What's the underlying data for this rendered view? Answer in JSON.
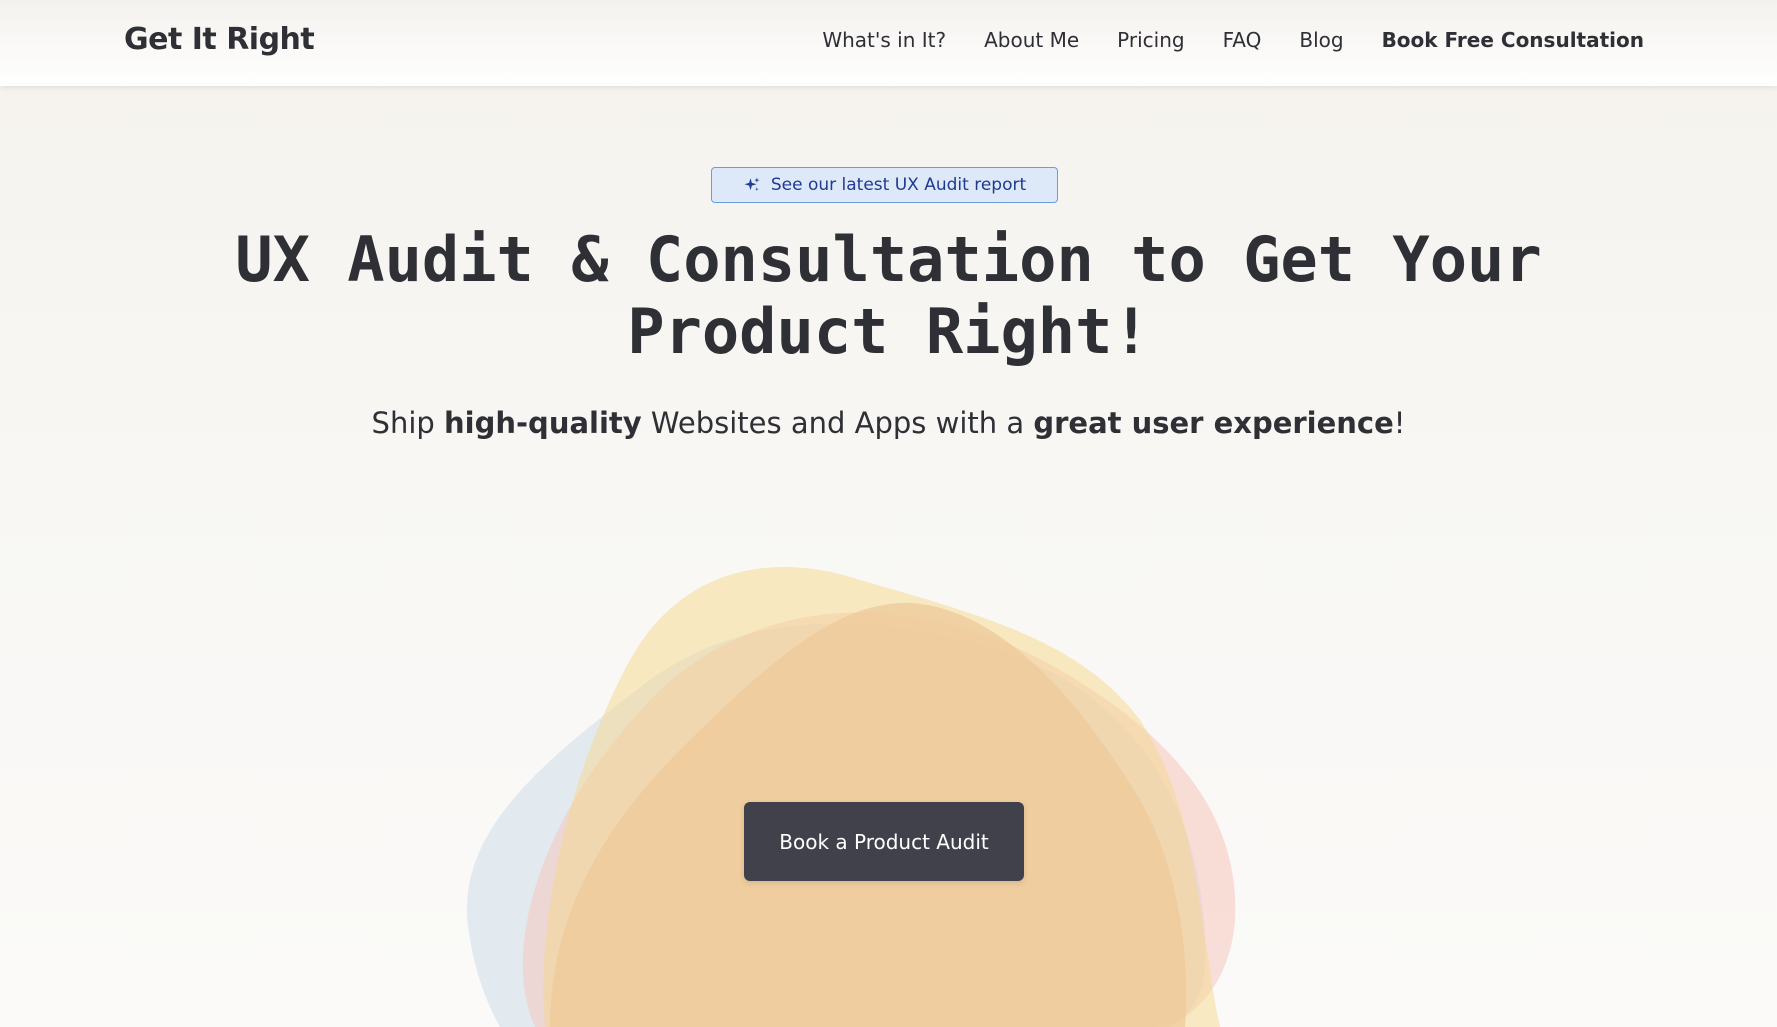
{
  "header": {
    "logo": "Get It Right",
    "nav": [
      {
        "label": "What's in It?"
      },
      {
        "label": "About Me"
      },
      {
        "label": "Pricing"
      },
      {
        "label": "FAQ"
      },
      {
        "label": "Blog"
      },
      {
        "label": "Book Free Consultation"
      }
    ]
  },
  "hero": {
    "badge": {
      "label": "See our latest UX Audit report",
      "icon": "sparkle-icon"
    },
    "headline_line1": "UX Audit & Consultation to Get Your",
    "headline_line2": "Product Right!",
    "subline": {
      "part1": "Ship ",
      "bold1": "high-quality",
      "part2": " Websites and Apps with a ",
      "bold2": "great user experience",
      "part3": "!"
    },
    "cta_label": "Book a Product Audit"
  },
  "colors": {
    "text": "#2f2f36",
    "cta_background": "#41414b",
    "badge_border": "#6a9ce0",
    "badge_background": "#dde9f9",
    "badge_text": "#1f3a8f",
    "blob_yellow": "#f5d88c",
    "blob_orange": "#eec99a",
    "blob_pink": "#f6c6be",
    "blob_blue": "#d9e4ee"
  }
}
